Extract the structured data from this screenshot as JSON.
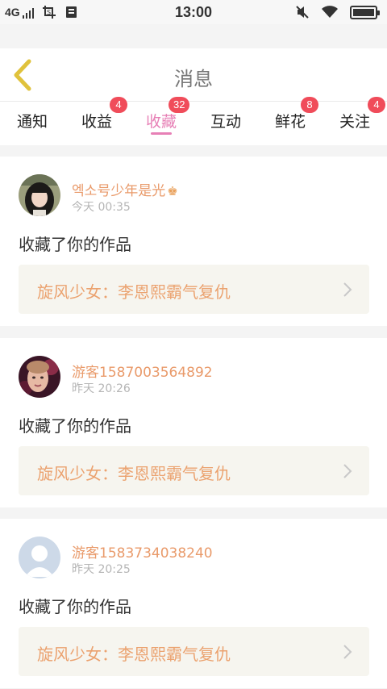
{
  "status_bar": {
    "network": "4G",
    "time": "13:00"
  },
  "header": {
    "title": "消息"
  },
  "tabs": [
    {
      "label": "通知",
      "badge": ""
    },
    {
      "label": "收益",
      "badge": "4"
    },
    {
      "label": "收藏",
      "badge": "32",
      "active": true
    },
    {
      "label": "互动",
      "badge": ""
    },
    {
      "label": "鲜花",
      "badge": "8"
    },
    {
      "label": "关注",
      "badge": "4"
    }
  ],
  "messages": [
    {
      "user": "엑소号少年是光",
      "crown": "♚",
      "time": "今天 00:35",
      "action": "收藏了你的作品",
      "work_title": "旋风少女：李恩熙霸气复仇",
      "avatar": "girl-avatar"
    },
    {
      "user": "游客1587003564892",
      "time": "昨天 20:26",
      "action": "收藏了你的作品",
      "work_title": "旋风少女：李恩熙霸气复仇",
      "avatar": "woman-avatar"
    },
    {
      "user": "游客1583734038240",
      "time": "昨天 20:25",
      "action": "收藏了你的作品",
      "work_title": "旋风少女：李恩熙霸气复仇",
      "avatar": "default-avatar"
    }
  ],
  "colors": {
    "accent_pink": "#e780b6",
    "badge_red": "#f04c5a",
    "username_orange": "#e99a6a",
    "back_icon_yellow": "#e0c23c"
  }
}
